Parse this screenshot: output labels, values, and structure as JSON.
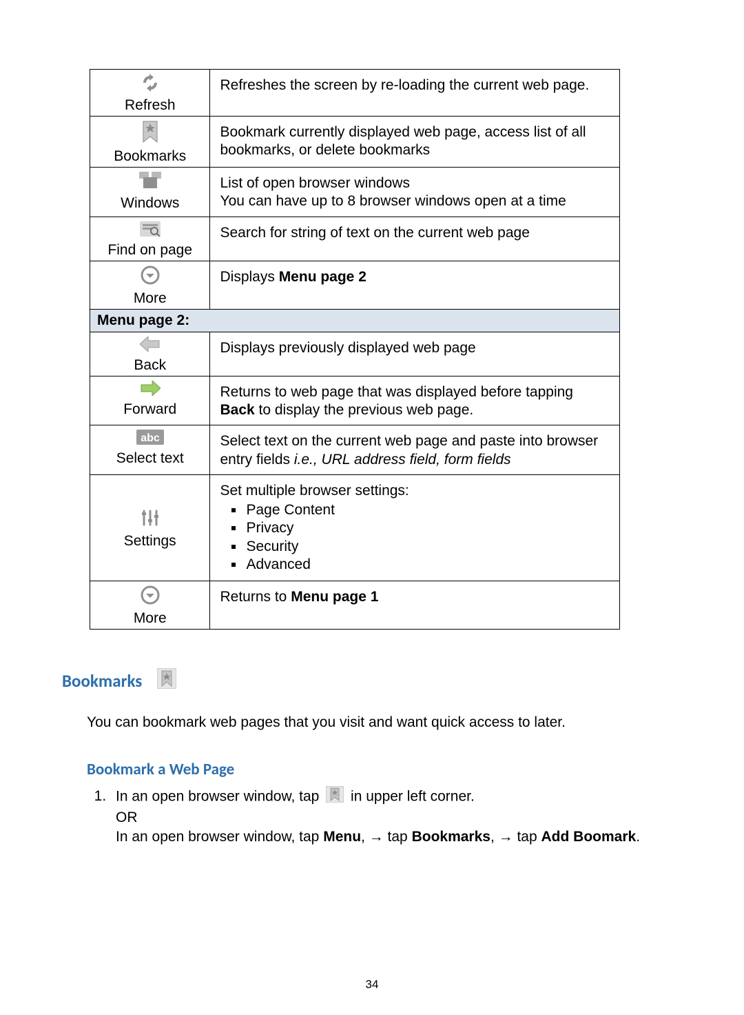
{
  "table": {
    "rows": [
      {
        "label": "Refresh",
        "desc": "Refreshes the screen by re-loading the current web page."
      },
      {
        "label": "Bookmarks",
        "desc": "Bookmark currently displayed web page, access list of all bookmarks, or delete bookmarks"
      },
      {
        "label": "Windows",
        "desc_line1": "List of open browser windows",
        "desc_line2": "You can have up to 8 browser windows open at a time"
      },
      {
        "label": "Find on page",
        "desc": "Search for string of text on the current web page"
      },
      {
        "label": "More",
        "desc_prefix": "Displays ",
        "desc_bold": "Menu page 2"
      }
    ],
    "section2_header": "Menu page 2:",
    "rows2": [
      {
        "label": "Back",
        "desc": "Displays previously displayed web page"
      },
      {
        "label": "Forward",
        "desc_part1": "Returns to web page that was displayed before tapping ",
        "desc_bold": "Back",
        "desc_part2": " to display the previous web page."
      },
      {
        "label": "Select text",
        "desc_part1": "Select text on the current web page and paste into browser entry fields ",
        "desc_italic": "i.e., URL address field, form fields"
      },
      {
        "label": "Settings",
        "desc_lead": "Set multiple browser settings:",
        "items": [
          "Page Content",
          "Privacy",
          "Security",
          "Advanced"
        ]
      },
      {
        "label": "More",
        "desc_prefix": "Returns to ",
        "desc_bold": "Menu page 1"
      }
    ]
  },
  "bookmarks_heading": "Bookmarks",
  "bookmarks_para": "You can bookmark web pages that you visit and want quick access to later.",
  "subheading": "Bookmark a Web Page",
  "step1": {
    "pre": "In an open browser window, tap ",
    "post": " in upper left corner.",
    "or": "OR",
    "line2_a": "In an open browser window, tap ",
    "line2_b": "Menu",
    "line2_c": ", ",
    "line2_d": " tap ",
    "line2_e": "Bookmarks",
    "line2_f": ", ",
    "line2_g": " tap ",
    "line2_h": "Add Boomark",
    "line2_i": "."
  },
  "page_number": "34"
}
